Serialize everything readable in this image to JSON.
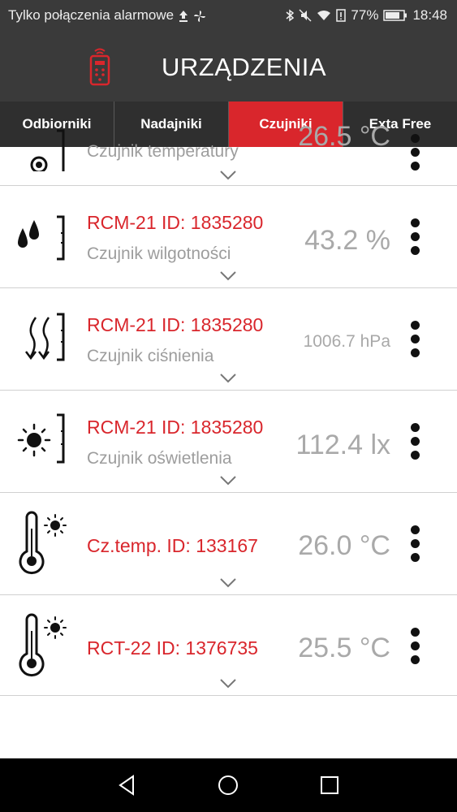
{
  "status_bar": {
    "carrier_text": "Tylko połączenia alarmowe",
    "battery": "77%",
    "time": "18:48"
  },
  "app_bar": {
    "title": "URZĄDZENIA"
  },
  "tabs": [
    {
      "label": "Odbiorniki",
      "active": false
    },
    {
      "label": "Nadajniki",
      "active": false
    },
    {
      "label": "Czujniki",
      "active": true
    },
    {
      "label": "Exta Free",
      "active": false
    }
  ],
  "sensors": [
    {
      "name": "",
      "type": "Czujnik temperatury",
      "value": "26.5 °C",
      "icon": "thermometer-gauge-icon"
    },
    {
      "name": "RCM-21 ID: 1835280",
      "type": "Czujnik wilgotności",
      "value": "43.2 %",
      "icon": "humidity-drops-icon"
    },
    {
      "name": "RCM-21 ID: 1835280",
      "type": "Czujnik ciśnienia",
      "value": "1006.7 hPa",
      "icon": "pressure-arrows-icon"
    },
    {
      "name": "RCM-21 ID: 1835280",
      "type": "Czujnik oświetlenia",
      "value": "112.4 lx",
      "icon": "sun-light-icon"
    },
    {
      "name": "Cz.temp. ID: 133167",
      "type": "",
      "value": "26.0 °C",
      "icon": "thermometer-sun-icon"
    },
    {
      "name": "RCT-22 ID: 1376735",
      "type": "",
      "value": "25.5 °C",
      "icon": "thermometer-sun-icon"
    }
  ],
  "colors": {
    "accent": "#d9262c",
    "bar_bg": "#3a3a3a",
    "value_gray": "#a9a9a9"
  }
}
